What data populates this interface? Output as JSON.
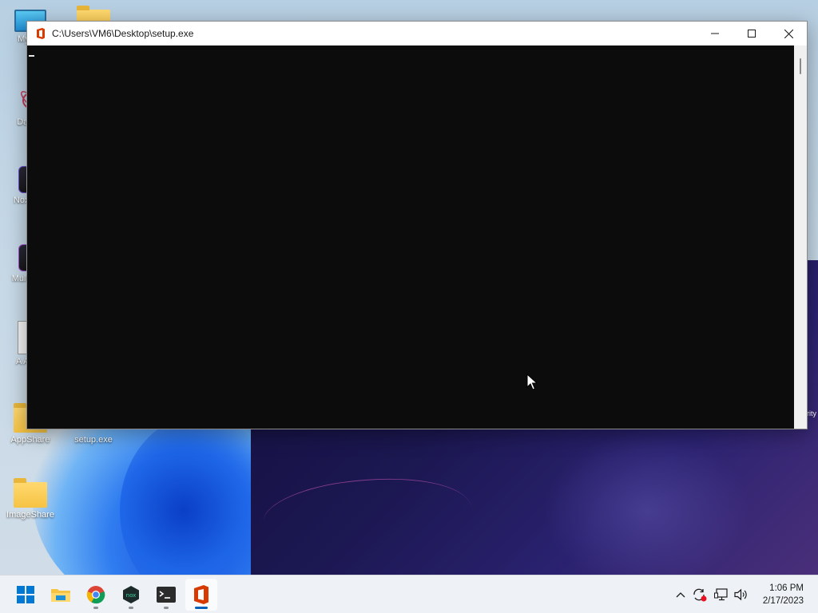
{
  "desktop": {
    "icons": [
      {
        "label": "My Co",
        "icon": "computer-icon"
      },
      {
        "label": "DataW",
        "icon": "datawrapper-shortcut-icon"
      },
      {
        "label": "Nox Sho",
        "icon": "nox-shortcut-icon"
      },
      {
        "label": "Multi - Sh",
        "icon": "multi-drive-shortcut-icon"
      },
      {
        "label": "A Antivi",
        "icon": "antivirus-icon"
      },
      {
        "label": "AppShare",
        "icon": "folder-icon"
      },
      {
        "label": "setup.exe",
        "icon": "setup-exe-icon"
      },
      {
        "label": "ImageShare",
        "icon": "folder-icon"
      }
    ],
    "partial_right_label": "rity"
  },
  "window": {
    "title": "C:\\Users\\VM6\\Desktop\\setup.exe",
    "app_icon": "office-icon",
    "minimize_icon": "minimize-icon",
    "maximize_icon": "maximize-icon",
    "close_icon": "close-icon",
    "console_text": ""
  },
  "taskbar": {
    "apps": [
      {
        "name": "start-button",
        "icon": "windows-start-icon",
        "active": false
      },
      {
        "name": "file-explorer",
        "icon": "file-explorer-icon",
        "active": false
      },
      {
        "name": "chrome",
        "icon": "chrome-icon",
        "active": false
      },
      {
        "name": "nox",
        "icon": "nox-icon",
        "active": false
      },
      {
        "name": "terminal",
        "icon": "terminal-icon",
        "active": false
      },
      {
        "name": "office-setup",
        "icon": "office-icon",
        "active": true
      }
    ],
    "tray": [
      "chevron-up-icon",
      "sync-alert-icon",
      "network-icon",
      "volume-icon"
    ],
    "time": "1:06 PM",
    "date": "2/17/2023"
  },
  "colors": {
    "console_bg": "#0c0c0c",
    "titlebar_bg": "#ffffff",
    "taskbar_bg": "#eef2f6",
    "accent": "#005fb8",
    "office_red": "#d83b01"
  }
}
